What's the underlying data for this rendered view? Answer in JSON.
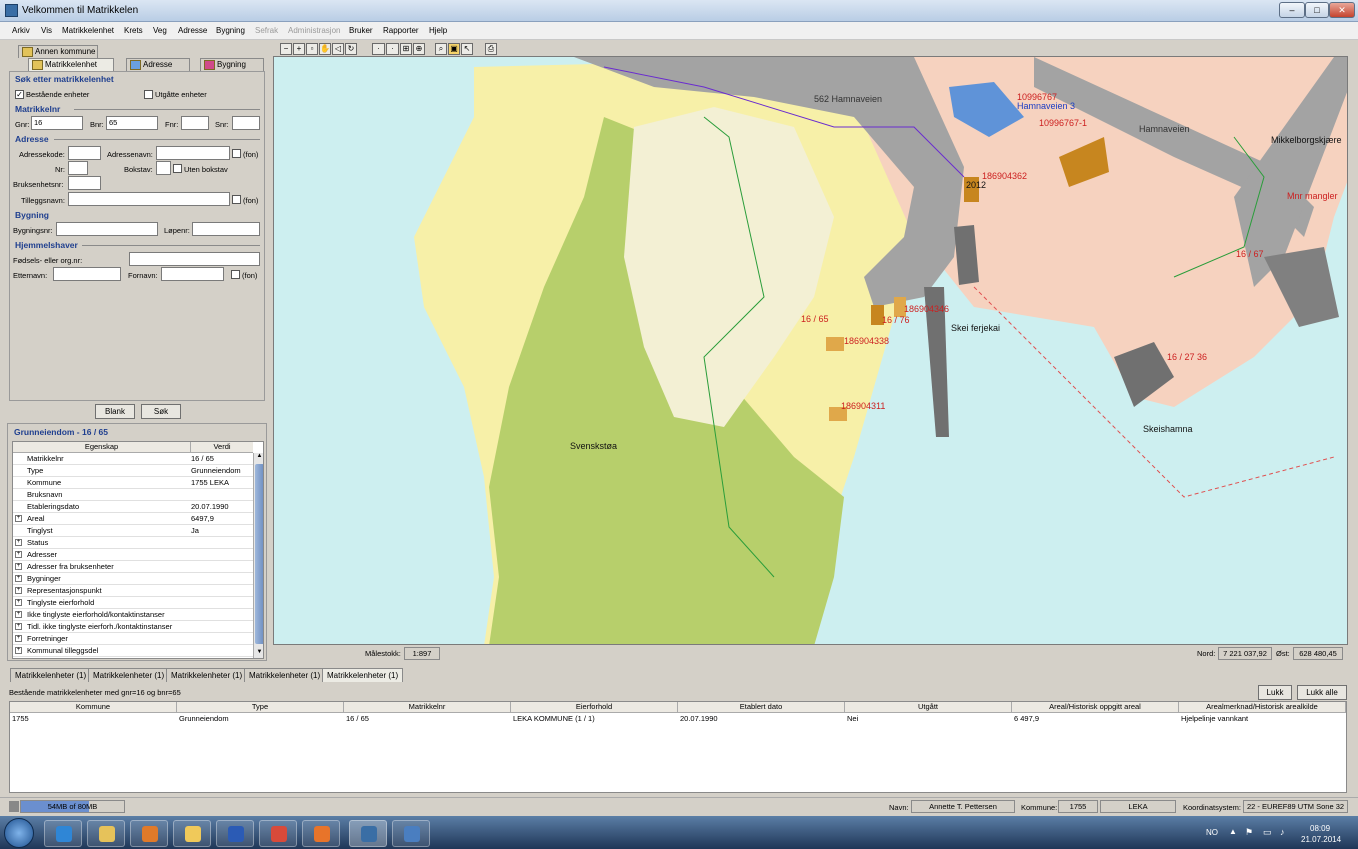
{
  "window": {
    "title": "Velkommen til Matrikkelen",
    "minimize": "–",
    "maximize": "□",
    "close": "✕"
  },
  "menu": [
    "Arkiv",
    "Vis",
    "Matrikkelenhet",
    "Krets",
    "Veg",
    "Adresse",
    "Bygning",
    "Sefrak",
    "Administrasjon",
    "Bruker",
    "Rapporter",
    "Hjelp"
  ],
  "menu_disabled": [
    "Sefrak",
    "Administrasjon"
  ],
  "search": {
    "tabs": [
      "Annen kommune",
      "Matrikkelenhet",
      "Adresse",
      "Bygning"
    ],
    "heading": "Søk etter matrikkelenhet",
    "existing_label": "Bestående enheter",
    "existing_checked": "✓",
    "expired_label": "Utgåtte enheter",
    "matrikkelnr_heading": "Matrikkelnr",
    "gnr_label": "Gnr:",
    "gnr_value": "16",
    "bnr_label": "Bnr:",
    "bnr_value": "65",
    "fnr_label": "Fnr:",
    "snr_label": "Snr:",
    "adresse_heading": "Adresse",
    "adressekode_label": "Adressekode:",
    "adressenavn_label": "Adressenavn:",
    "fon_label": "(fon)",
    "nr_label": "Nr:",
    "bokstav_label": "Bokstav:",
    "uten_bokstav_label": "Uten bokstav",
    "bruksenhetsnr_label": "Bruksenhetsnr:",
    "tilleggsnavn_label": "Tilleggsnavn:",
    "bygning_heading": "Bygning",
    "bygningsnr_label": "Bygningsnr:",
    "lopenr_label": "Løpenr:",
    "hjemmelshaver_heading": "Hjemmelshaver",
    "fodsel_label": "Fødsels- eller org.nr:",
    "etternavn_label": "Etternavn:",
    "fornavn_label": "Fornavn:",
    "blank_button": "Blank",
    "sok_button": "Søk"
  },
  "properties": {
    "title": "Grunneiendom - 16 / 65",
    "col_key": "Egenskap",
    "col_value": "Verdi",
    "rows": [
      {
        "k": "Matrikkelnr",
        "v": "16 / 65",
        "x": ""
      },
      {
        "k": "Type",
        "v": "Grunneiendom",
        "x": ""
      },
      {
        "k": "Kommune",
        "v": "1755  LEKA",
        "x": ""
      },
      {
        "k": "Bruksnavn",
        "v": "",
        "x": ""
      },
      {
        "k": "Etableringsdato",
        "v": "20.07.1990",
        "x": ""
      },
      {
        "k": "Areal",
        "v": "6497,9",
        "x": "+"
      },
      {
        "k": "Tinglyst",
        "v": "Ja",
        "x": ""
      },
      {
        "k": "Status",
        "v": "",
        "x": "+"
      },
      {
        "k": "Adresser",
        "v": "",
        "x": "+"
      },
      {
        "k": "Adresser fra bruksenheter",
        "v": "",
        "x": "+"
      },
      {
        "k": "Bygninger",
        "v": "",
        "x": "+"
      },
      {
        "k": "Representasjonspunkt",
        "v": "",
        "x": "+"
      },
      {
        "k": "Tinglyste eierforhold",
        "v": "",
        "x": "+"
      },
      {
        "k": "Ikke tinglyste eierforhold/kontaktinstanser",
        "v": "",
        "x": "+"
      },
      {
        "k": "Tidl. ikke tinglyste eierforh./kontaktinstanser",
        "v": "",
        "x": "+"
      },
      {
        "k": "Forretninger",
        "v": "",
        "x": "+"
      },
      {
        "k": "Kommunal tilleggsdel",
        "v": "",
        "x": "+"
      }
    ]
  },
  "map": {
    "labels": {
      "road1": "562 Hamnaveien",
      "road2": "Hamnaveien",
      "addr_id": "10996767",
      "addr": "Hamnaveien 3",
      "addr_id2": "10996767-1",
      "mikkel": "Mikkelborgskjære",
      "mnr": "Mnr mangler",
      "b1": "186904362",
      "b2": "2012",
      "b3": "186904346",
      "b4": "16 / 76",
      "b5": "186904338",
      "b6": "186904311",
      "p1": "16 / 65",
      "p2": "16 / 67",
      "p3": "16 / 27 36",
      "ferje": "Skei ferjekai",
      "svensk": "Svenskstøa",
      "skeis": "Skeishamna"
    },
    "scale_label": "Målestokk:",
    "scale_value": "1:897",
    "nord_label": "Nord:",
    "nord_value": "7 221 037,92",
    "ost_label": "Øst:",
    "ost_value": "628 480,45",
    "colors": {
      "sea": "#cdeff0",
      "land_yellow": "#f7f0a8",
      "green": "#b7cf6b",
      "light": "#f3f0d4",
      "road": "#a3a3a3",
      "pink": "#f6d2bf",
      "parcel": "#e0a84a"
    }
  },
  "results": {
    "tabs": [
      "Matrikkelenheter (1)",
      "Matrikkelenheter (1)",
      "Matrikkelenheter (1)",
      "Matrikkelenheter (1)",
      "Matrikkelenheter (1)"
    ],
    "subtitle": "Bestående matrikkelenheter med gnr=16 og bnr=65",
    "lukk": "Lukk",
    "lukk_alle": "Lukk alle",
    "headers": [
      "Kommune",
      "Type",
      "Matrikkelnr",
      "Eierforhold",
      "Etablert dato",
      "Utgått",
      "Areal/Historisk oppgitt areal",
      "Arealmerknad/Historisk arealkilde"
    ],
    "row": [
      "1755",
      "Grunneiendom",
      "16 / 65",
      "LEKA KOMMUNE (1 / 1)",
      "20.07.1990",
      "Nei",
      "6 497,9",
      "Hjelpelinje vannkant"
    ]
  },
  "status": {
    "memory": "54MB of 80MB",
    "navn_label": "Navn:",
    "navn": "Annette T. Pettersen",
    "kommune_label": "Kommune:",
    "kommune_nr": "1755",
    "kommune_navn": "LEKA",
    "koord_label": "Koordinatsystem:",
    "koord": "22 - EUREF89 UTM Sone 32"
  },
  "taskbar": {
    "lang": "NO",
    "time": "08:09",
    "date": "21.07.2014"
  }
}
